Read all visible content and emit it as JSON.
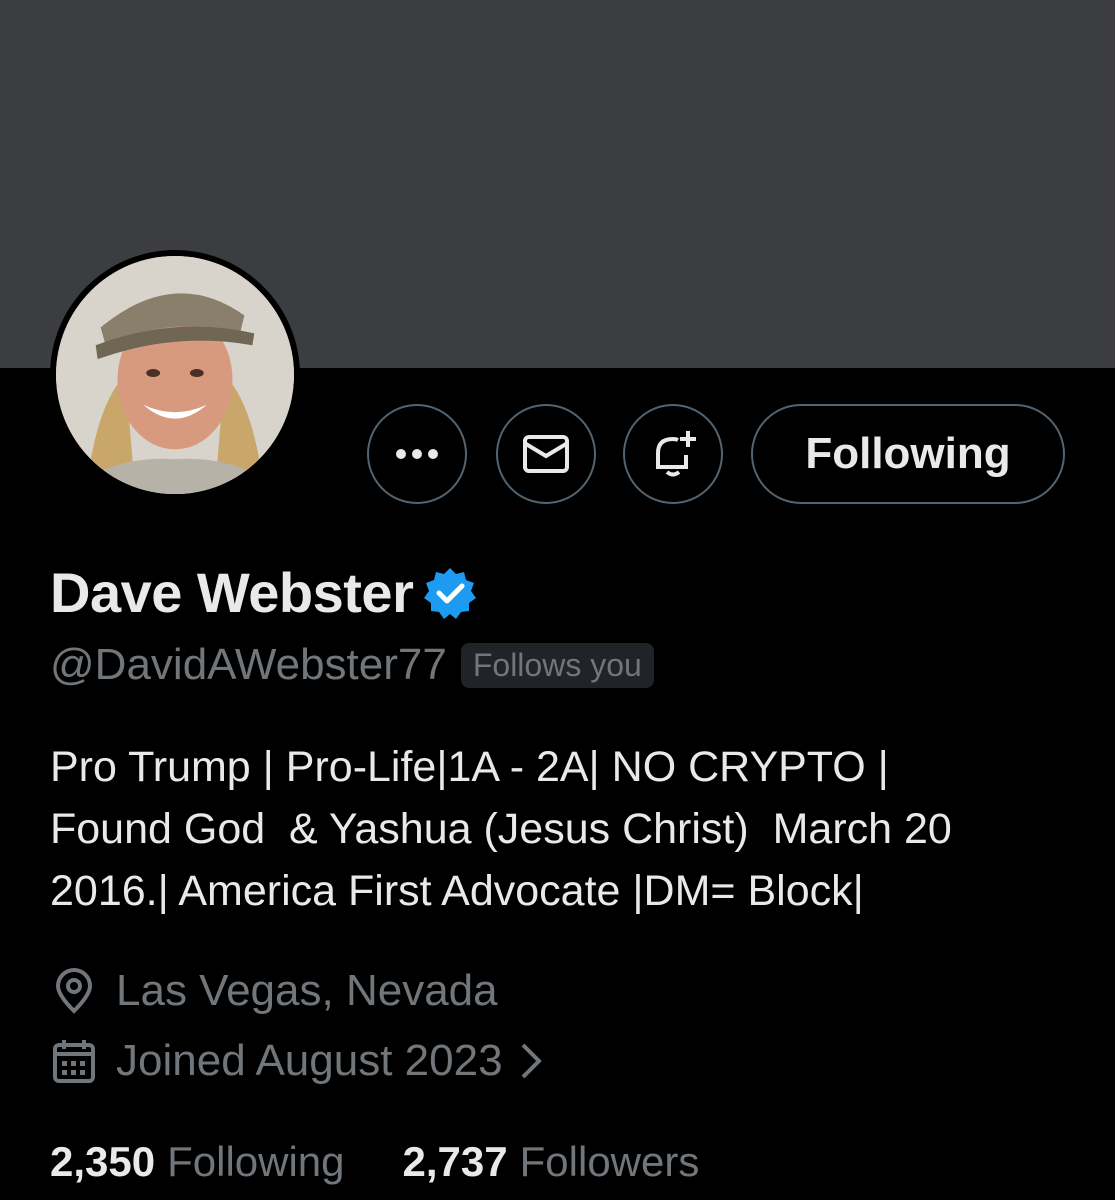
{
  "profile": {
    "display_name": "Dave Webster",
    "handle": "@DavidAWebster77",
    "follows_you_badge": "Follows you",
    "verified_color": "#1d9bf0",
    "bio_lines": [
      "Pro Trump | Pro-Life|1A - 2A| NO CRYPTO |",
      "Found God  & Yashua (Jesus Christ)  March 20",
      "2016.| America First Advocate |DM= Block|"
    ],
    "location": "Las Vegas, Nevada",
    "joined": "Joined August 2023",
    "following_count": "2,350",
    "following_label": "Following",
    "followers_count": "2,737",
    "followers_label": "Followers"
  },
  "actions": {
    "more_icon": "more-icon",
    "message_icon": "mail-icon",
    "notify_icon": "bell-plus-icon",
    "following_button_label": "Following"
  },
  "icons": {
    "location": "location-pin-icon",
    "joined": "calendar-icon",
    "joined_chevron": "chevron-right-icon"
  },
  "colors": {
    "background": "#000000",
    "banner": "#3b3d40",
    "primary_text": "#e7e9ea",
    "secondary_text": "#71767b",
    "border": "#536471"
  }
}
